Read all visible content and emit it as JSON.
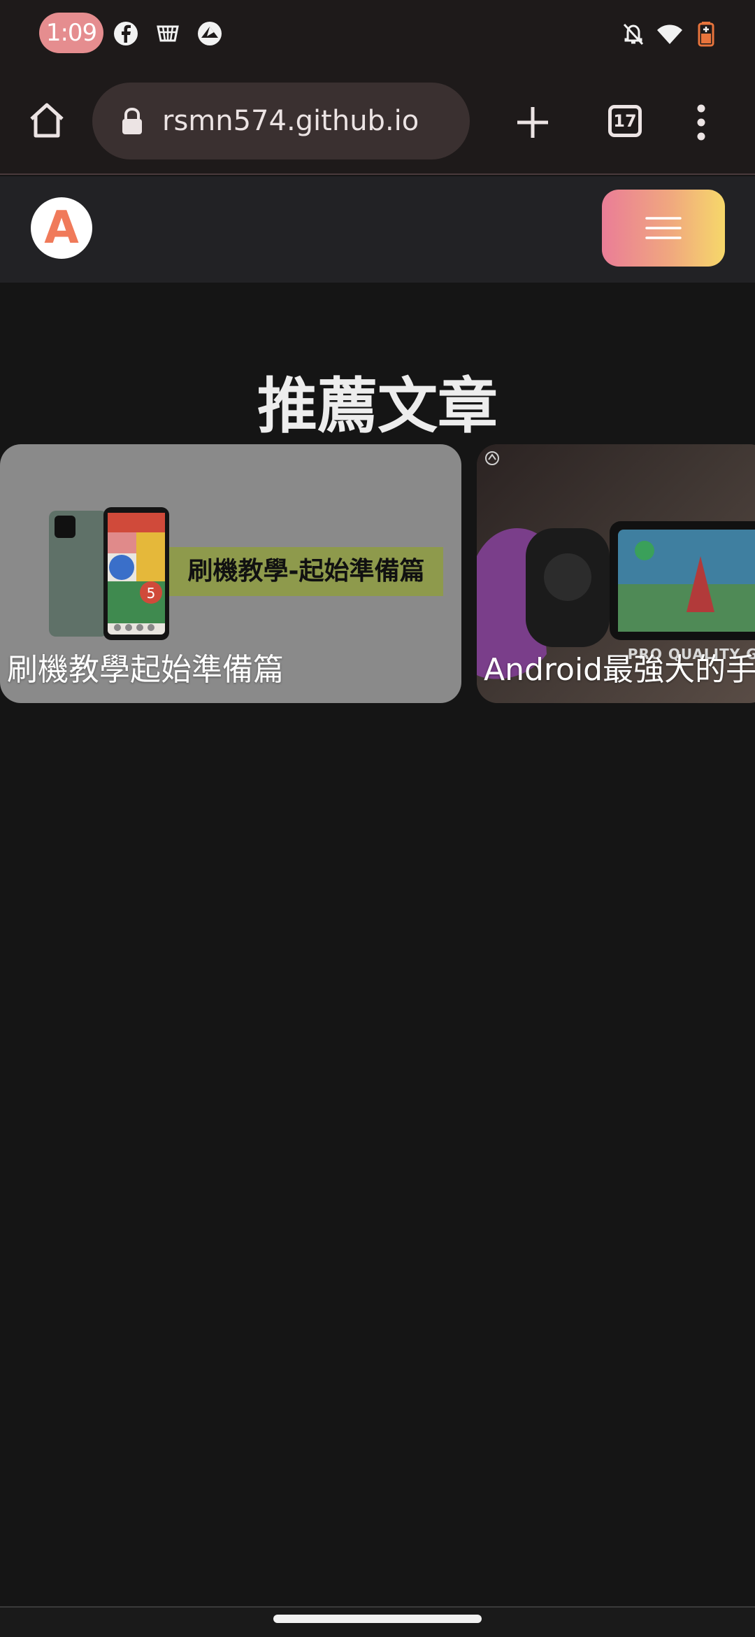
{
  "status_bar": {
    "time": "1:09",
    "left_icons": [
      "facebook-icon",
      "app-icon",
      "app-icon-2"
    ],
    "right_icons": [
      "bell-off-icon",
      "wifi-icon",
      "battery-icon"
    ]
  },
  "browser": {
    "url": "rsmn574.github.io",
    "tab_count": "17"
  },
  "site": {
    "logo_letter": "A",
    "section_title": "推薦文章",
    "cards": [
      {
        "caption": "刷機教學起始準備篇",
        "banner_text": "刷機教學-起始準備篇",
        "phone_badge": "5"
      },
      {
        "caption": "Android最強大的手",
        "overlay_text": "PRO QUALITY GAM"
      }
    ]
  },
  "colors": {
    "accent_gradient_start": "#ea7d97",
    "accent_gradient_end": "#f6d86a",
    "time_pill": "#e58d8f"
  }
}
